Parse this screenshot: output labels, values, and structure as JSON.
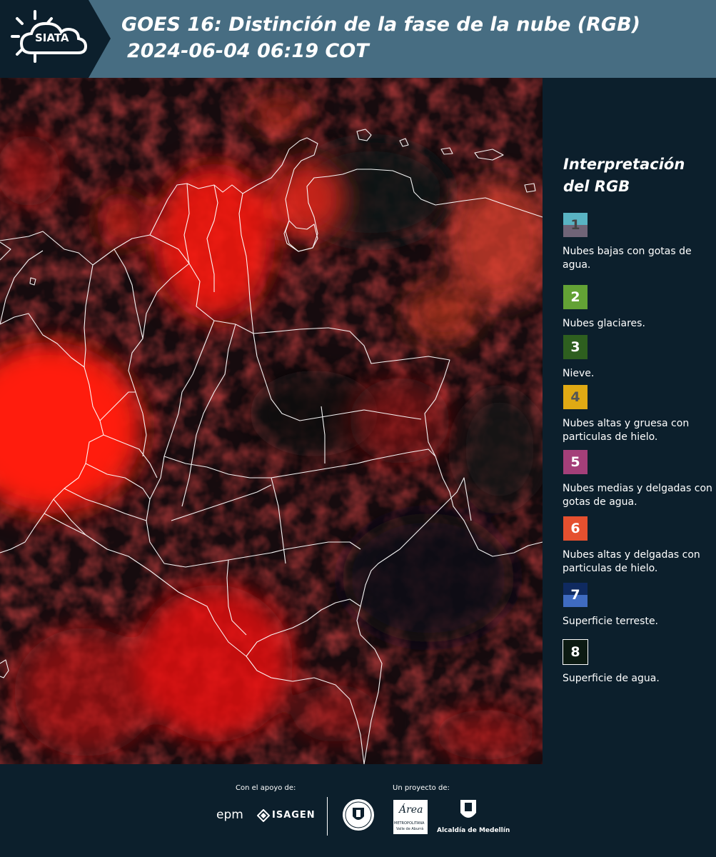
{
  "header": {
    "logo_text": "SIATA",
    "title_line1": "GOES 16: Distinción de la fase de la nube (RGB)",
    "title_line2": "2024-06-04 06:19 COT"
  },
  "legend": {
    "title_line1": "Interpretación",
    "title_line2": "del RGB",
    "items": [
      {
        "number": "1",
        "colors": [
          "#59b3c3",
          "#706477"
        ],
        "text_color": "#444444",
        "label": "Nubes bajas con gotas de agua."
      },
      {
        "number": "2",
        "colors": [
          "#63a235",
          "#63a235"
        ],
        "text_color": "#ffffff",
        "label": "Nubes glaciares."
      },
      {
        "number": "3",
        "colors": [
          "#2e5f1f",
          "#2e5f1f"
        ],
        "text_color": "#ffffff",
        "label": "Nieve."
      },
      {
        "number": "4",
        "colors": [
          "#e0aa14",
          "#e0aa14"
        ],
        "text_color": "#555555",
        "label": "Nubes altas y gruesa con particulas de hielo."
      },
      {
        "number": "5",
        "colors": [
          "#a43f79",
          "#a43f79"
        ],
        "text_color": "#ffffff",
        "label": "Nubes medias y delgadas con gotas de agua."
      },
      {
        "number": "6",
        "colors": [
          "#e5502f",
          "#e5502f"
        ],
        "text_color": "#ffffff",
        "label": "Nubes altas y delgadas con particulas de hielo."
      },
      {
        "number": "7",
        "colors": [
          "#0f2a60",
          "#3f6bc1"
        ],
        "text_color": "#ffffff",
        "label": "Superficie terreste."
      },
      {
        "number": "8",
        "colors": [
          "#0c1a12",
          "#0c1a12"
        ],
        "text_color": "#ffffff",
        "label": "Superficie de agua."
      }
    ]
  },
  "footer": {
    "support_label": "Con el apoyo de:",
    "project_label": "Un proyecto de:",
    "sponsors": [
      "epm",
      "ISAGEN"
    ],
    "partners": {
      "area_name": "Área",
      "area_sub": "METROPOLITANA",
      "area_sub2": "Valle de Aburrá",
      "alcaldia": "Alcaldía de Medellín"
    }
  },
  "colors": {
    "header_bg": "#476d82",
    "panel_bg": "#0c1f2c",
    "cloud_red": "#ff1a10"
  }
}
